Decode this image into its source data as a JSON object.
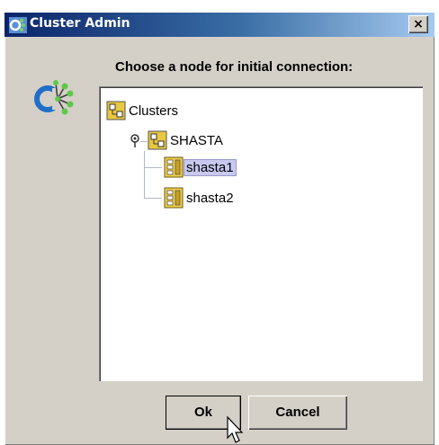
{
  "window": {
    "title": "Cluster Admin",
    "close_label": "×"
  },
  "dialog": {
    "prompt": "Choose a node for initial connection:"
  },
  "tree": {
    "root": {
      "label": "Clusters",
      "icon": "cluster-folder-icon"
    },
    "cluster": {
      "label": "SHASTA",
      "icon": "cluster-folder-icon",
      "toggle": "expand-pin-icon"
    },
    "nodes": [
      {
        "label": "shasta1",
        "icon": "server-icon",
        "selected": true
      },
      {
        "label": "shasta2",
        "icon": "server-icon",
        "selected": false
      }
    ]
  },
  "buttons": {
    "ok": "Ok",
    "cancel": "Cancel"
  },
  "colors": {
    "titlebar_start": "#0a246a",
    "titlebar_end": "#a6caf0",
    "selection": "#c8c8f0",
    "face": "#d4d0c8"
  }
}
